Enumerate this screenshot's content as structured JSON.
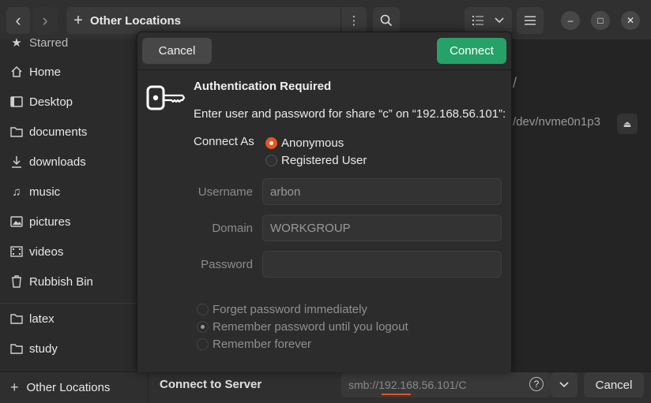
{
  "header": {
    "back": "‹",
    "forward": "›",
    "location_title": "Other Locations",
    "add_symbol": "+",
    "kebab": "⋮",
    "search": "⌕",
    "view_list": "☰",
    "view_dropdown": "⌄",
    "main_menu": "≡",
    "minimize": "–",
    "maximize": "□",
    "close": "✕"
  },
  "sidebar": {
    "items": [
      {
        "label": "Starred",
        "icon": "star-icon"
      },
      {
        "label": "Home",
        "icon": "home-icon"
      },
      {
        "label": "Desktop",
        "icon": "desktop-icon"
      },
      {
        "label": "documents",
        "icon": "folder-icon"
      },
      {
        "label": "downloads",
        "icon": "download-icon"
      },
      {
        "label": "music",
        "icon": "music-icon"
      },
      {
        "label": "pictures",
        "icon": "picture-icon"
      },
      {
        "label": "videos",
        "icon": "video-icon"
      },
      {
        "label": "Rubbish Bin",
        "icon": "trash-icon"
      },
      {
        "label": "latex",
        "icon": "folder-icon"
      },
      {
        "label": "study",
        "icon": "folder-icon"
      }
    ],
    "other_locations": "Other Locations"
  },
  "main": {
    "root_path": "/",
    "device_path": "/dev/nvme0n1p3",
    "eject": "⏏"
  },
  "bottombar": {
    "connect_label": "Connect to Server",
    "server_address": "smb://192.168.56.101/C",
    "help": "?",
    "dropdown": "⌄",
    "cancel": "Cancel"
  },
  "dialog": {
    "cancel": "Cancel",
    "connect": "Connect",
    "title": "Authentication Required",
    "message": "Enter user and password for share “c” on “192.168.56.101”:",
    "connect_as": "Connect As",
    "radio_anonymous": "Anonymous",
    "radio_registered": "Registered User",
    "username_label": "Username",
    "username_value": "arbon",
    "domain_label": "Domain",
    "domain_value": "WORKGROUP",
    "password_label": "Password",
    "password_value": "",
    "opt_forget": "Forget password immediately",
    "opt_remember_logout": "Remember password until you logout",
    "opt_remember_forever": "Remember forever"
  },
  "colors": {
    "accent": "#e95420",
    "connect_button": "#26a269"
  }
}
